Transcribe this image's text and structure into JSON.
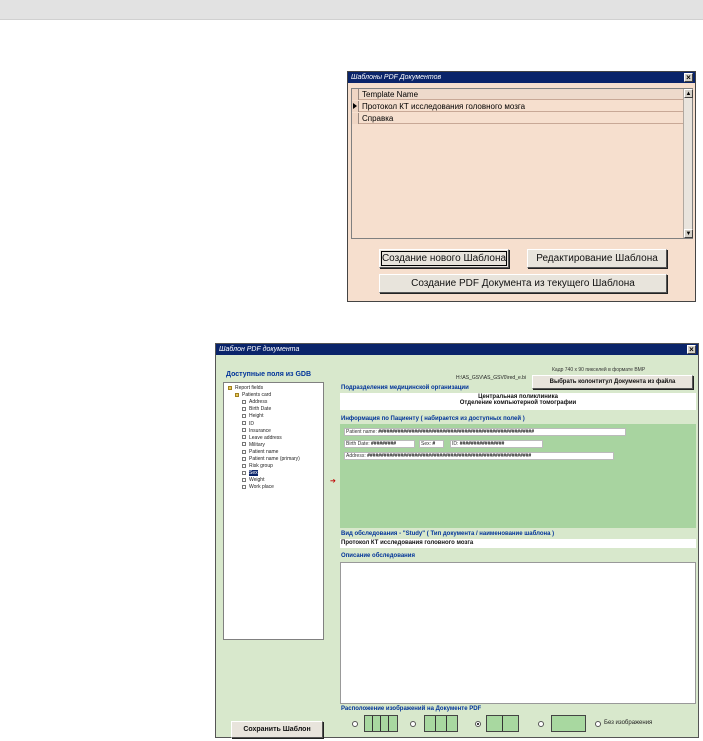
{
  "window1": {
    "title": "Шаблоны PDF Документов",
    "column_header": "Template Name",
    "rows": [
      "Протокол КТ исследования головного мозга",
      "Справка"
    ],
    "buttons": {
      "create_new": "Создание нового Шаблона",
      "edit": "Редактирование Шаблона",
      "create_pdf": "Создание PDF Документа из текущего Шаблона"
    }
  },
  "window2": {
    "title": "Шаблон PDF документа",
    "left": {
      "title": "Доступные поля из GDB",
      "tree": [
        {
          "label": "Report fields",
          "type": "folder",
          "level": 0
        },
        {
          "label": "Patients card",
          "type": "folder",
          "level": 1
        },
        {
          "label": "Address",
          "type": "doc",
          "level": 2
        },
        {
          "label": "Birth Date",
          "type": "doc",
          "level": 2
        },
        {
          "label": "Height",
          "type": "doc",
          "level": 2
        },
        {
          "label": "ID",
          "type": "doc",
          "level": 2
        },
        {
          "label": "Insurance",
          "type": "doc",
          "level": 2
        },
        {
          "label": "Leave address",
          "type": "doc",
          "level": 2
        },
        {
          "label": "Military",
          "type": "doc",
          "level": 2
        },
        {
          "label": "Patient name",
          "type": "doc",
          "level": 2
        },
        {
          "label": "Patient name (primary)",
          "type": "doc",
          "level": 2
        },
        {
          "label": "Risk group",
          "type": "doc",
          "level": 2
        },
        {
          "label": "Sex",
          "type": "doc",
          "level": 2,
          "selected": true
        },
        {
          "label": "Weight",
          "type": "doc",
          "level": 2
        },
        {
          "label": "Work place",
          "type": "doc",
          "level": 2
        }
      ],
      "save_button": "Сохранить Шаблон"
    },
    "header": {
      "path": "H:\\AS_GSV\\AS_GSV0\\red_e.bi",
      "frame_note": "Кадр 740 x 90 пикселей в формате BMP",
      "pick_button": "Выбрать колонтитул Документа из файла"
    },
    "department": {
      "label": "Подразделения медицинской организации",
      "line1": "Центральная поликлиника",
      "line2": "Отделение компьютерной томографии"
    },
    "patient": {
      "label": "Информация по Пациенту ( набирается из доступных полей )",
      "name_label": "Patient name:",
      "name_value": "########################################################",
      "birth_label": "Birth Date:",
      "birth_value": "#########",
      "sex_label": "Sex:",
      "sex_value": "#",
      "id_label": "ID:",
      "id_value": "################",
      "address_label": "Address:",
      "address_value": "###########################################################"
    },
    "study": {
      "label": "Вид обследования - \"Study\" ( Тип документа / наименование шаблона )",
      "value": "Протокол КТ исследования головного мозга"
    },
    "description": {
      "label": "Описание обследования"
    },
    "images": {
      "label": "Расположение изображений на Документе PDF",
      "selected_index": 2,
      "no_images": "Без изображения"
    }
  }
}
